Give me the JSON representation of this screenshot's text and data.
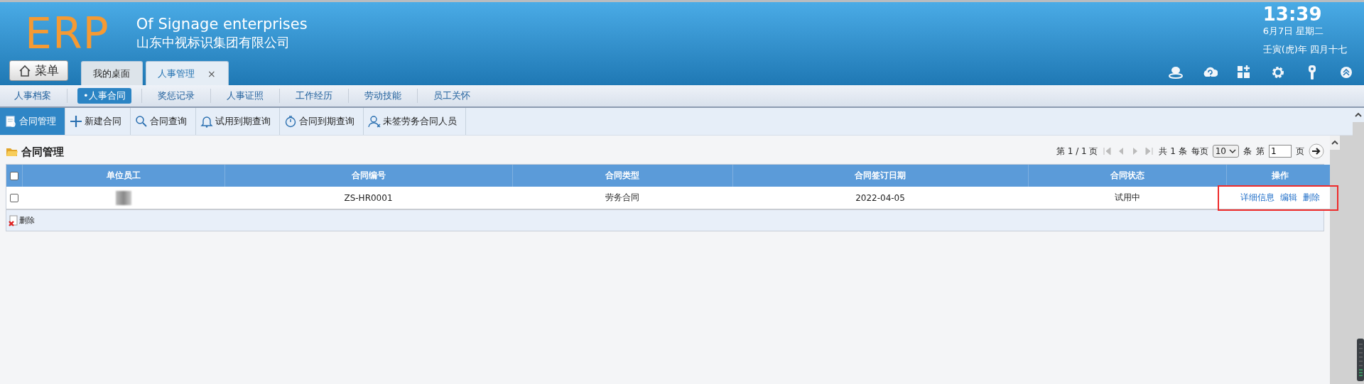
{
  "header": {
    "logo": "ERP",
    "title_en": "Of Signage enterprises",
    "title_cn": "山东中视标识集团有限公司",
    "clock": {
      "time": "13:39",
      "date": "6月7日 星期二",
      "lunar": "壬寅(虎)年 四月十七"
    }
  },
  "menu_button": "菜单",
  "tabs": [
    {
      "label": "我的桌面",
      "selected": false
    },
    {
      "label": "人事管理",
      "selected": true,
      "close": "×"
    }
  ],
  "subnav": [
    {
      "label": "人事档案",
      "selected": false
    },
    {
      "label": "•人事合同",
      "selected": true
    },
    {
      "label": "奖惩记录",
      "selected": false
    },
    {
      "label": "人事证照",
      "selected": false
    },
    {
      "label": "工作经历",
      "selected": false
    },
    {
      "label": "劳动技能",
      "selected": false
    },
    {
      "label": "员工关怀",
      "selected": false
    }
  ],
  "toolbar": [
    {
      "label": "合同管理",
      "selected": true
    },
    {
      "label": "新建合同",
      "selected": false
    },
    {
      "label": "合同查询",
      "selected": false
    },
    {
      "label": "试用到期查询",
      "selected": false
    },
    {
      "label": "合同到期查询",
      "selected": false
    },
    {
      "label": "未签劳务合同人员",
      "selected": false
    }
  ],
  "panel": {
    "title": "合同管理",
    "pagination": {
      "page_info": "第 1 / 1 页",
      "total": "共 1 条",
      "per_page_label": "每页",
      "per_page": "10",
      "unit": "条",
      "goto_label": "第",
      "goto_page": "1",
      "page_unit": "页"
    },
    "table": {
      "select_all": false,
      "columns": [
        "单位员工",
        "合同编号",
        "合同类型",
        "合同签订日期",
        "合同状态",
        "操作"
      ],
      "rows": [
        {
          "checked": false,
          "cells": [
            "",
            "ZS-HR0001",
            "劳务合同",
            "2022-04-05",
            "试用中"
          ],
          "actions": [
            "详细信息",
            "编辑",
            "删除"
          ],
          "highlighted": true
        }
      ]
    },
    "footer_button": "删除"
  }
}
